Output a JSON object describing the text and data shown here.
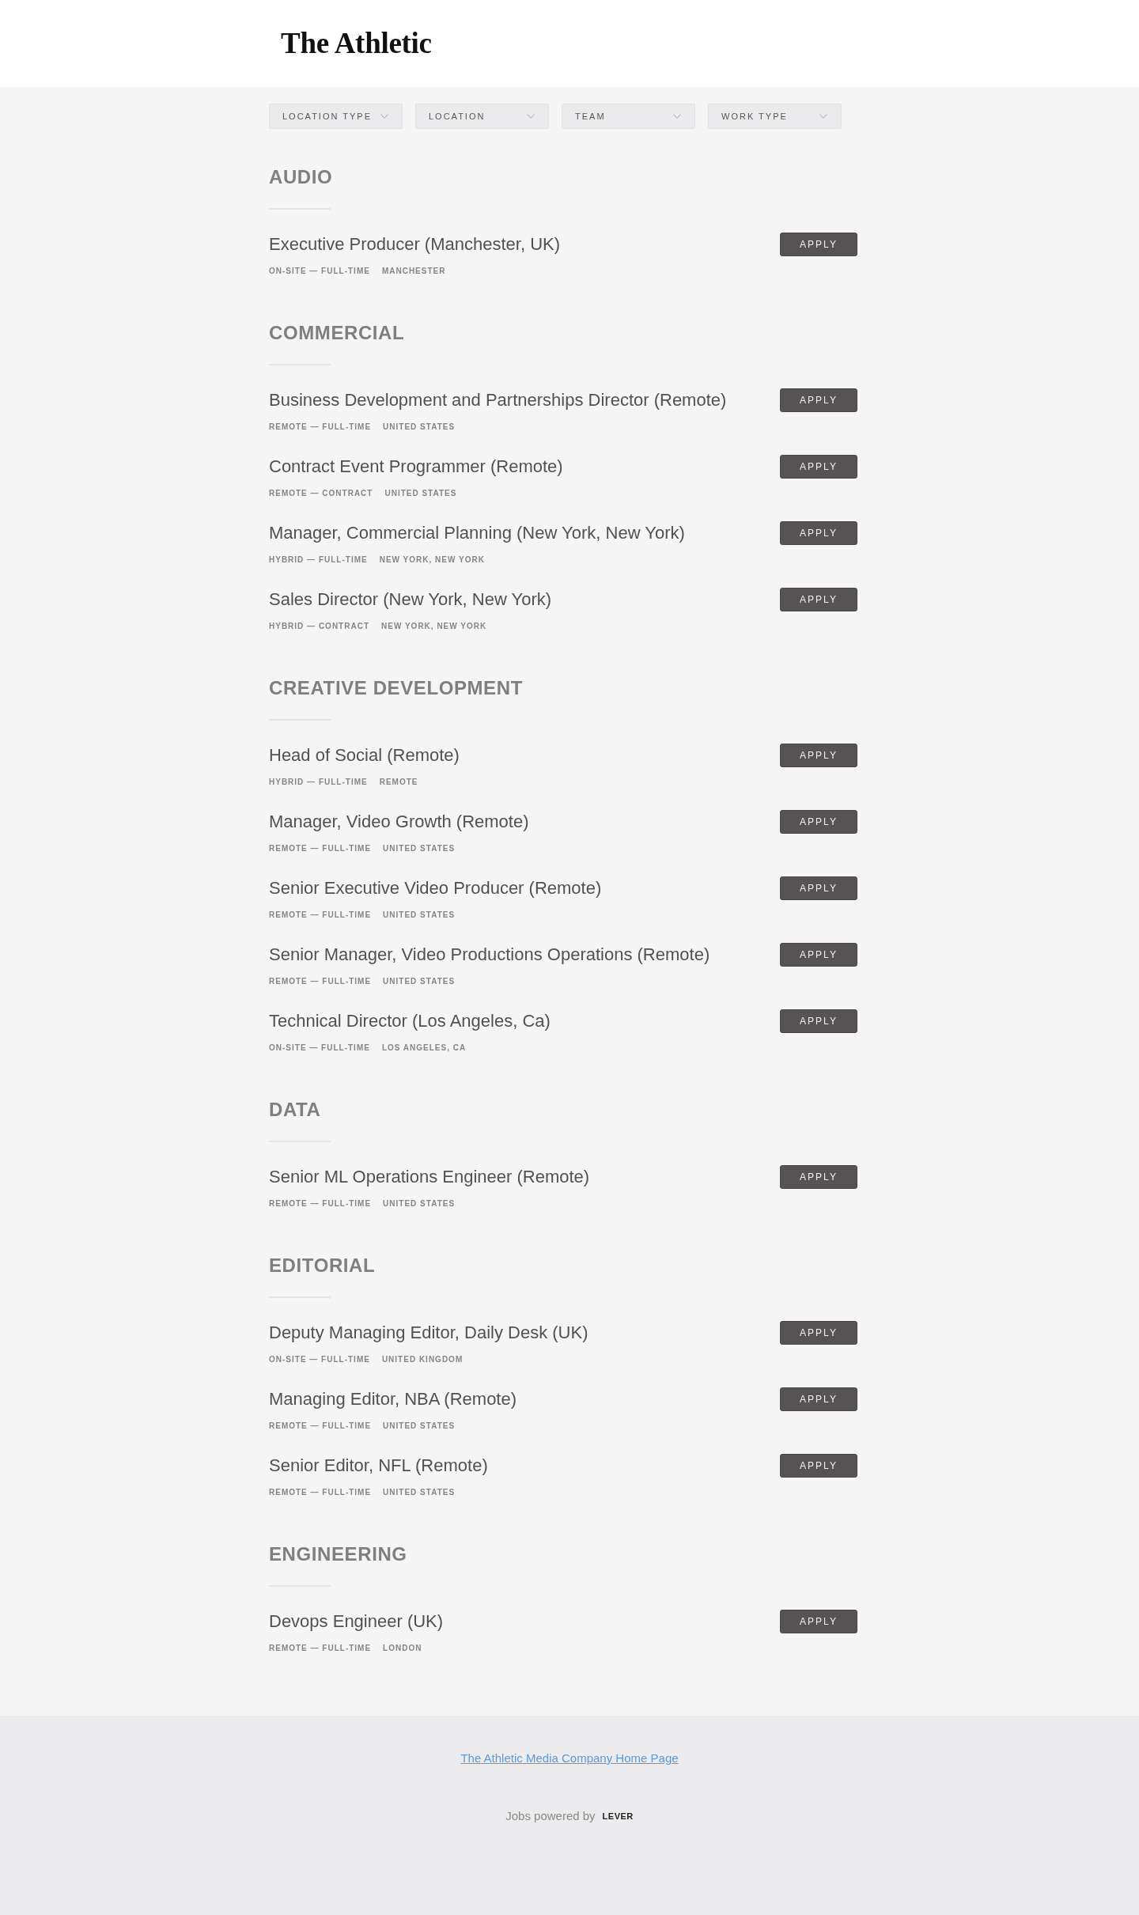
{
  "header": {
    "logo": "The Athletic"
  },
  "filters": [
    {
      "label": "LOCATION TYPE"
    },
    {
      "label": "LOCATION"
    },
    {
      "label": "TEAM"
    },
    {
      "label": "WORK TYPE"
    }
  ],
  "sections": [
    {
      "title": "AUDIO",
      "postings": [
        {
          "title": "Executive Producer (Manchester, UK)",
          "commitment": "ON-SITE — FULL-TIME",
          "location": "MANCHESTER",
          "button": "APPLY"
        }
      ]
    },
    {
      "title": "COMMERCIAL",
      "postings": [
        {
          "title": "Business Development and Partnerships Director (Remote)",
          "commitment": "REMOTE — FULL-TIME",
          "location": "UNITED STATES",
          "button": "APPLY"
        },
        {
          "title": "Contract Event Programmer (Remote)",
          "commitment": "REMOTE — CONTRACT",
          "location": "UNITED STATES",
          "button": "APPLY"
        },
        {
          "title": "Manager, Commercial Planning (New York, New York)",
          "commitment": "HYBRID — FULL-TIME",
          "location": "NEW YORK, NEW YORK",
          "button": "APPLY"
        },
        {
          "title": "Sales Director (New York, New York)",
          "commitment": "HYBRID — CONTRACT",
          "location": "NEW YORK, NEW YORK",
          "button": "APPLY"
        }
      ]
    },
    {
      "title": "CREATIVE DEVELOPMENT",
      "postings": [
        {
          "title": "Head of Social (Remote)",
          "commitment": "HYBRID — FULL-TIME",
          "location": "REMOTE",
          "button": "APPLY"
        },
        {
          "title": "Manager, Video Growth (Remote)",
          "commitment": "REMOTE — FULL-TIME",
          "location": "UNITED STATES",
          "button": "APPLY"
        },
        {
          "title": "Senior Executive Video Producer (Remote)",
          "commitment": "REMOTE — FULL-TIME",
          "location": "UNITED STATES",
          "button": "APPLY"
        },
        {
          "title": "Senior Manager, Video Productions Operations (Remote)",
          "commitment": "REMOTE — FULL-TIME",
          "location": "UNITED STATES",
          "button": "APPLY"
        },
        {
          "title": "Technical Director (Los Angeles, Ca)",
          "commitment": "ON-SITE — FULL-TIME",
          "location": "LOS ANGELES, CA",
          "button": "APPLY"
        }
      ]
    },
    {
      "title": "DATA",
      "postings": [
        {
          "title": "Senior ML Operations Engineer (Remote)",
          "commitment": "REMOTE — FULL-TIME",
          "location": "UNITED STATES",
          "button": "APPLY"
        }
      ]
    },
    {
      "title": "EDITORIAL",
      "postings": [
        {
          "title": "Deputy Managing Editor, Daily Desk (UK)",
          "commitment": "ON-SITE — FULL-TIME",
          "location": "UNITED KINGDOM",
          "button": "APPLY"
        },
        {
          "title": "Managing Editor, NBA (Remote)",
          "commitment": "REMOTE — FULL-TIME",
          "location": "UNITED STATES",
          "button": "APPLY"
        },
        {
          "title": "Senior Editor, NFL (Remote)",
          "commitment": "REMOTE — FULL-TIME",
          "location": "UNITED STATES",
          "button": "APPLY"
        }
      ]
    },
    {
      "title": "ENGINEERING",
      "postings": [
        {
          "title": "Devops Engineer (UK)",
          "commitment": "REMOTE — FULL-TIME",
          "location": "LONDON",
          "button": "APPLY"
        }
      ]
    }
  ],
  "footer": {
    "link": "The Athletic Media Company Home Page",
    "powered_by": "Jobs powered by",
    "powered_logo": "LEVER"
  }
}
